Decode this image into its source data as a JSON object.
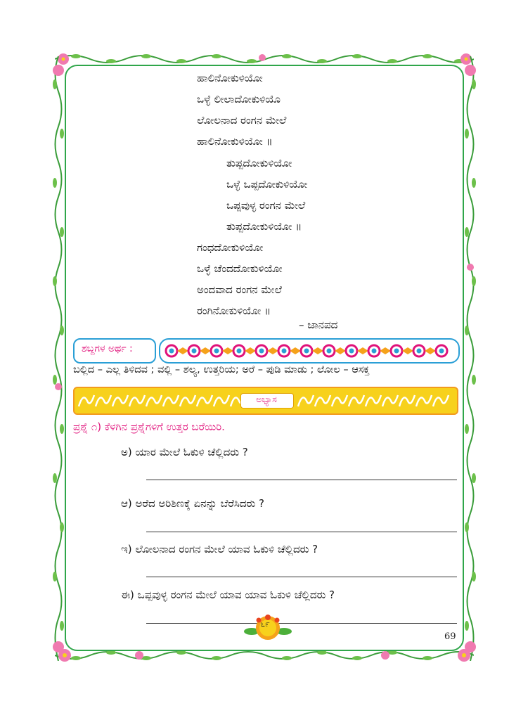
{
  "poem": {
    "lines": [
      "ಹಾಲಿನೋಕುಳಿಯೋ",
      "ಒಳ್ಳೆ ಲೀಲಾದೋಕುಳಿಯೊ",
      "ಲೋಲನಾದ ರಂಗನ ಮೇಲೆ",
      "ಹಾಲಿನೋಕುಳಿಯೋ ॥",
      "ತುಪ್ಪದೋಕುಳಿಯೋ",
      "ಒಳ್ಳೆ ಒಪ್ಪದೋಕುಳಿಯೋ",
      "ಒಪ್ಪವುಳ್ಳ ರಂಗನ ಮೇಲೆ",
      "ತುಪ್ಪದೋಕುಳಿಯೋ ॥",
      "ಗಂಧದೋಕುಳಿಯೋ",
      "ಒಳ್ಳೆ ಚೆಂದದೋಕುಳಿಯೋ",
      "ಅಂದವಾದ ರಂಗನ ಮೇಲೆ",
      "ರಂಗಿನೋಕುಳಿಯೋ ॥"
    ],
    "source": "– ಜಾನಪದ"
  },
  "meanings": {
    "label": "ಶಬ್ದಗಳ ಅರ್ಥ :",
    "text": "ಬಲ್ಲಿದ – ಎಲ್ಲ ತಿಳಿದವ ; ವಲ್ಲಿ – ಶಲ್ಯ, ಉತ್ತರಿಯ; ಅರೆ – ಪುಡಿ ಮಾಡು ; ಲೋಲ – ಆಸಕ್ತ"
  },
  "exercise": {
    "label": "ಅಭ್ಯಾಸ"
  },
  "question_set": {
    "heading": "ಪ್ರಶ್ನೆ ೧)   ಕೆಳಗಿನ ಪ್ರಶ್ನೆಗಳಿಗೆ ಉತ್ತರ ಬರೆಯಿರಿ.",
    "items": [
      "ಅ)  ಯಾರ ಮೇಲೆ ಓಕುಳಿ ಚೆಲ್ಲಿದರು ?",
      "ಆ)  ಅರೆದ ಅರಿಶಿಣಕ್ಕೆ ಏನನ್ನು ಬೆರೆಸಿದರು ?",
      "ಇ)  ಲೋಲನಾದ ರಂಗನ ಮೇಲೆ ಯಾವ ಓಕುಳಿ ಚೆಲ್ಲಿದರು ?",
      "ಈ)  ಒಪ್ಪವುಳ್ಳ  ರಂಗನ ಮೇಲೆ ಯಾವ ಯಾವ ಓಕುಳಿ ಚೆಲ್ಲಿದರು ?"
    ]
  },
  "footer": {
    "badge_text": "೬೯",
    "page_number": "69"
  },
  "colors": {
    "accent_pink": "#e0127a",
    "border_green": "#2fa64a",
    "box_blue": "#2a9fd6",
    "banner_yellow": "#f7d11c"
  }
}
